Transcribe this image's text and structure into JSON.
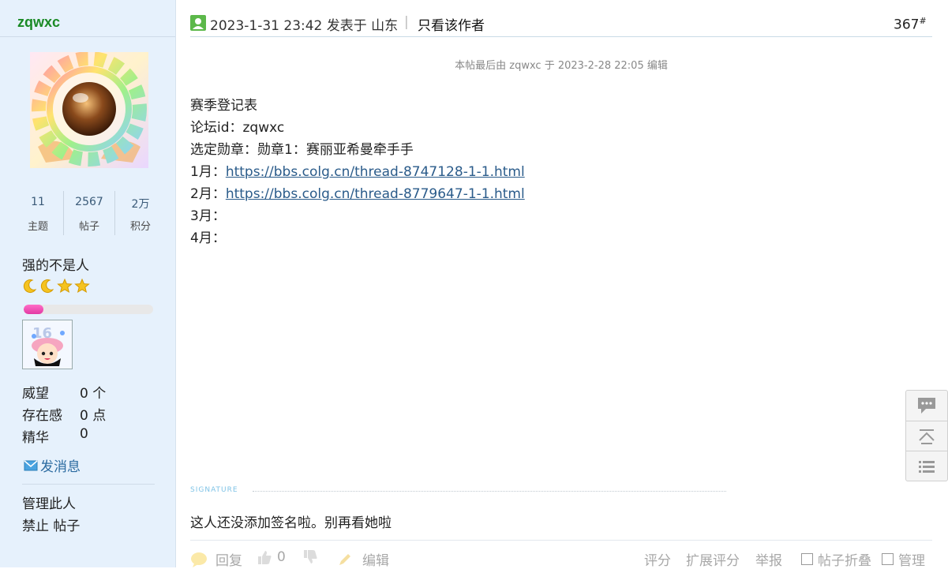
{
  "sidebar": {
    "username": "zqwxc",
    "stats": [
      {
        "num": "11",
        "label": "主题"
      },
      {
        "num": "2567",
        "label": "帖子"
      },
      {
        "num": "2万",
        "label": "积分"
      }
    ],
    "rank_title": "强的不是人",
    "level_progress": 0.15,
    "credits": [
      {
        "key": "威望",
        "value": "0 个"
      },
      {
        "key": "存在感",
        "value": "0 点"
      },
      {
        "key": "精华",
        "value": "0"
      }
    ],
    "send_message": "发消息",
    "manage_label": "管理此人",
    "ban_label": "禁止",
    "posts_label": "帖子"
  },
  "post": {
    "time": "2023-1-31 23:42 发表于 山东",
    "separator": "|",
    "only_author": "只看该作者",
    "floor": "367",
    "floor_mark": "#",
    "edited_note": "本帖最后由 zqwxc 于 2023-2-28 22:05 编辑",
    "lines": [
      {
        "text": "赛季登记表"
      },
      {
        "text": "论坛id：zqwxc"
      },
      {
        "text": "选定勋章：勋章1：赛丽亚希曼牵手手"
      },
      {
        "prefix": "1月：",
        "link": "https://bbs.colg.cn/thread-8747128-1-1.html"
      },
      {
        "prefix": "2月：",
        "link": "https://bbs.colg.cn/thread-8779647-1-1.html"
      },
      {
        "text": "3月："
      },
      {
        "text": "4月："
      }
    ],
    "signature_label": "SIGNATURE",
    "signature_text": "这人还没添加签名啦。别再看她啦"
  },
  "footer": {
    "reply": "回复",
    "like_count": "0",
    "edit": "编辑",
    "rate": "评分",
    "ext_rate": "扩展评分",
    "report": "举报",
    "fold": "帖子折叠",
    "manage": "管理"
  },
  "colors": {
    "username": "#1a8a25",
    "sidebar_bg": "#e6f1fc",
    "link": "#2a5b8a",
    "progress": "#e23aa3"
  }
}
